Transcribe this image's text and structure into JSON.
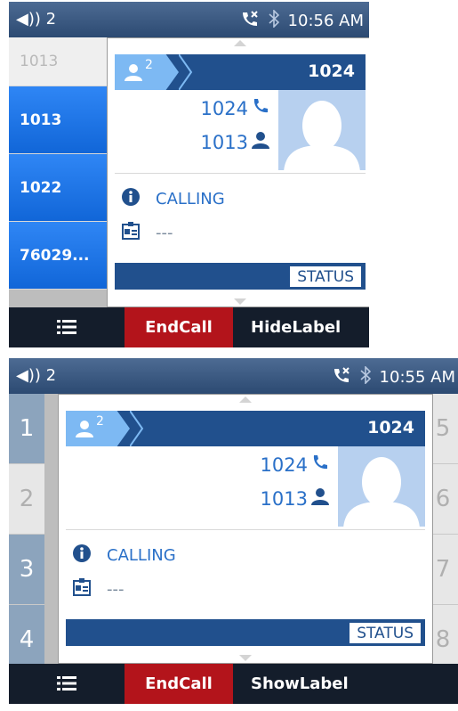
{
  "screen1": {
    "status": {
      "volume": "◀)) 2",
      "time": "10:56 AM"
    },
    "left_keys": [
      "1013",
      "1013",
      "1022",
      "76029..."
    ],
    "popup": {
      "header_number": "1024",
      "participant_count": "2",
      "line1": "1024",
      "line2": "1013",
      "status_text": "CALLING",
      "info2": "---",
      "status_button": "STATUS"
    },
    "softkeys": {
      "endcall": "EndCall",
      "label_toggle": "HideLabel"
    }
  },
  "screen2": {
    "status": {
      "volume": "◀)) 2",
      "time": "10:55 AM"
    },
    "left_numbers": [
      "1",
      "2",
      "3",
      "4"
    ],
    "right_numbers": [
      "5",
      "6",
      "7",
      "8"
    ],
    "popup": {
      "header_number": "1024",
      "participant_count": "2",
      "line1": "1024",
      "line2": "1013",
      "status_text": "CALLING",
      "info2": "---",
      "status_button": "STATUS"
    },
    "softkeys": {
      "endcall": "EndCall",
      "label_toggle": "ShowLabel"
    }
  },
  "colors": {
    "accent_blue": "#21508d",
    "key_blue": "#1a73e8",
    "end_red": "#b3141b",
    "softbar": "#141d2b"
  },
  "icons": [
    "volume-icon",
    "missed-call-icon",
    "bluetooth-icon",
    "menu-icon",
    "phone-icon",
    "person-icon",
    "info-icon",
    "contact-card-icon"
  ]
}
